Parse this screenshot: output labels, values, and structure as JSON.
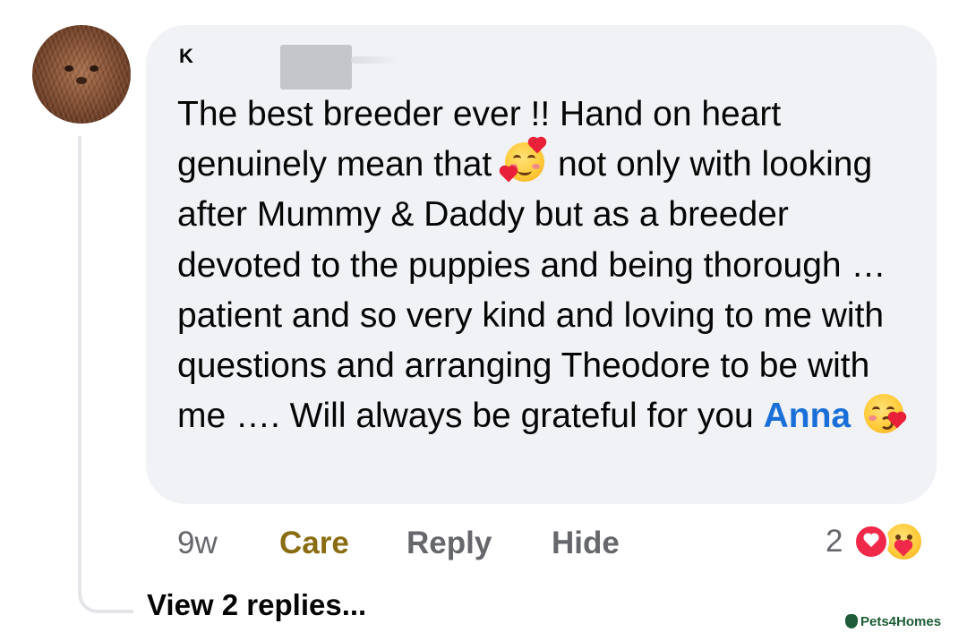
{
  "comment": {
    "author_partial": "K",
    "text_before_emoji_1": "The best breeder ever !! Hand on heart genuinely mean that",
    "emoji_1": "smiling-face-with-hearts",
    "text_between": "not only with looking after Mummy & Daddy but as a breeder devoted to the puppies and being thorough …patient and so very kind and loving to me with questions and arranging Theodore to be with me …. Will always be grateful for you",
    "mention": "Anna",
    "emoji_2": "face-blowing-kiss"
  },
  "actions": {
    "time": "9w",
    "reaction_label": "Care",
    "reply_label": "Reply",
    "hide_label": "Hide"
  },
  "reactions": {
    "count": "2",
    "icons": [
      "love-icon",
      "care-icon"
    ]
  },
  "replies": {
    "label": "View 2 replies..."
  },
  "watermark": {
    "text": "Pets4Homes"
  },
  "colors": {
    "bubble": "#f0f2f5",
    "mention": "#1a6fd8",
    "care_reaction": "#8a6d12",
    "love": "#f02849",
    "watermark": "#1d5c36"
  }
}
